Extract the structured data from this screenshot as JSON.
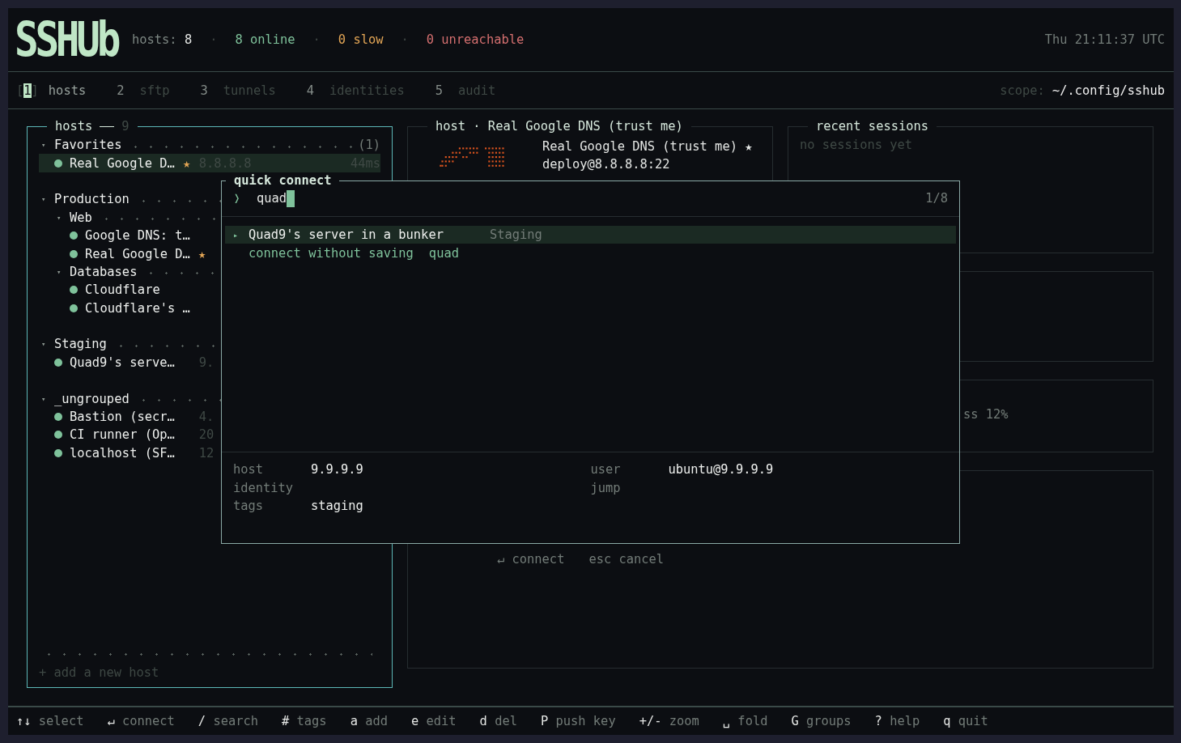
{
  "header": {
    "logo": "SSHUb",
    "stats": [
      {
        "kind": "total",
        "text": "hosts:",
        "value": "8"
      },
      {
        "kind": "sep",
        "text": "·"
      },
      {
        "kind": "online",
        "text": "8 online"
      },
      {
        "kind": "sep",
        "text": "·"
      },
      {
        "kind": "slow",
        "text": "0 slow"
      },
      {
        "kind": "sep",
        "text": "·"
      },
      {
        "kind": "unreachable",
        "text": "0 unreachable"
      }
    ],
    "clock": "Thu 21:11:37 UTC"
  },
  "tabbar": {
    "marks": [
      "[",
      "]"
    ],
    "tabs": [
      {
        "key": "1",
        "label": "hosts",
        "selected": true
      },
      {
        "key": "2",
        "label": "sftp",
        "selected": false
      },
      {
        "key": "3",
        "label": "tunnels",
        "selected": false
      },
      {
        "key": "4",
        "label": "identities",
        "selected": false
      },
      {
        "key": "5",
        "label": "audit",
        "selected": false
      }
    ],
    "scope_label": "scope:",
    "scope": "~/.config/sshub"
  },
  "hosts_panel": {
    "title": "hosts",
    "count": "9",
    "groups": [
      {
        "toggle": "▾",
        "name": "Favorites",
        "expanded": true,
        "count": "(1)",
        "hosts": [
          {
            "name": "Real Google D…",
            "star": "★",
            "addr": "8.8.8.8",
            "latency": "44ms",
            "selected": true
          }
        ]
      },
      {
        "toggle": "▾",
        "name": "Production",
        "expanded": true,
        "children": [
          {
            "toggle": "▾",
            "name": "Web",
            "expanded": true,
            "hosts": [
              {
                "name": "Google DNS: t…",
                "selected": false
              },
              {
                "name": "Real Google D…",
                "star": "★",
                "selected": false
              }
            ]
          },
          {
            "toggle": "▾",
            "name": "Databases",
            "expanded": true,
            "hosts": [
              {
                "name": "Cloudflare",
                "selected": false
              },
              {
                "name": "Cloudflare's …",
                "selected": false
              }
            ]
          }
        ]
      },
      {
        "toggle": "▾",
        "name": "Staging",
        "expanded": true,
        "hosts": [
          {
            "name": "Quad9's serve…",
            "addr": "9.",
            "selected": false
          }
        ]
      },
      {
        "toggle": "▾",
        "name": "_ungrouped",
        "expanded": true,
        "hosts": [
          {
            "name": "Bastion (secr…",
            "addr": "4.",
            "selected": false
          },
          {
            "name": "CI runner (Op…",
            "addr": "20",
            "selected": false
          },
          {
            "name": "localhost (SF…",
            "addr": "12",
            "selected": false
          }
        ]
      }
    ],
    "add": "+ add a new host"
  },
  "host_panel": {
    "title": "host · Real Google DNS (trust me)",
    "name": "Real Google DNS (trust me)",
    "star": "★",
    "address": "deploy@8.8.8.8:22"
  },
  "sessions_panel": {
    "title": "recent sessions",
    "empty": "no sessions yet"
  },
  "stats_panel": {
    "text": "ss 12%"
  },
  "hints": [
    {
      "key": "↵",
      "label": "connect"
    },
    {
      "key": "esc",
      "label": "cancel"
    }
  ],
  "quick_connect": {
    "title": "quick connect",
    "prompt": "❭",
    "query": "quad",
    "counter": "1/8",
    "results": [
      {
        "kind": "host",
        "marker": "▸",
        "name": "Quad9's server in a bunker",
        "group": "Staging",
        "selected": true
      },
      {
        "kind": "action",
        "name": "connect without saving",
        "arg": "quad",
        "selected": false
      }
    ],
    "details_left": [
      {
        "label": "host",
        "value": "9.9.9.9"
      },
      {
        "label": "identity"
      },
      {
        "label": "tags",
        "value": "staging"
      }
    ],
    "details_right": [
      {
        "label": "user",
        "value": "ubuntu@9.9.9.9"
      },
      {
        "label": "jump"
      }
    ]
  },
  "footer": [
    {
      "key": "↑↓",
      "label": "select"
    },
    {
      "key": "↵",
      "label": "connect"
    },
    {
      "key": "/",
      "label": "search"
    },
    {
      "key": "#",
      "label": "tags"
    },
    {
      "key": "a",
      "label": "add"
    },
    {
      "key": "e",
      "label": "edit"
    },
    {
      "key": "d",
      "label": "del"
    },
    {
      "key": "P",
      "label": "push key"
    },
    {
      "key": "+/-",
      "label": "zoom"
    },
    {
      "key": "␣",
      "label": "fold"
    },
    {
      "key": "G",
      "label": "groups"
    },
    {
      "key": "?",
      "label": "help"
    },
    {
      "key": "q",
      "label": "quit"
    }
  ]
}
